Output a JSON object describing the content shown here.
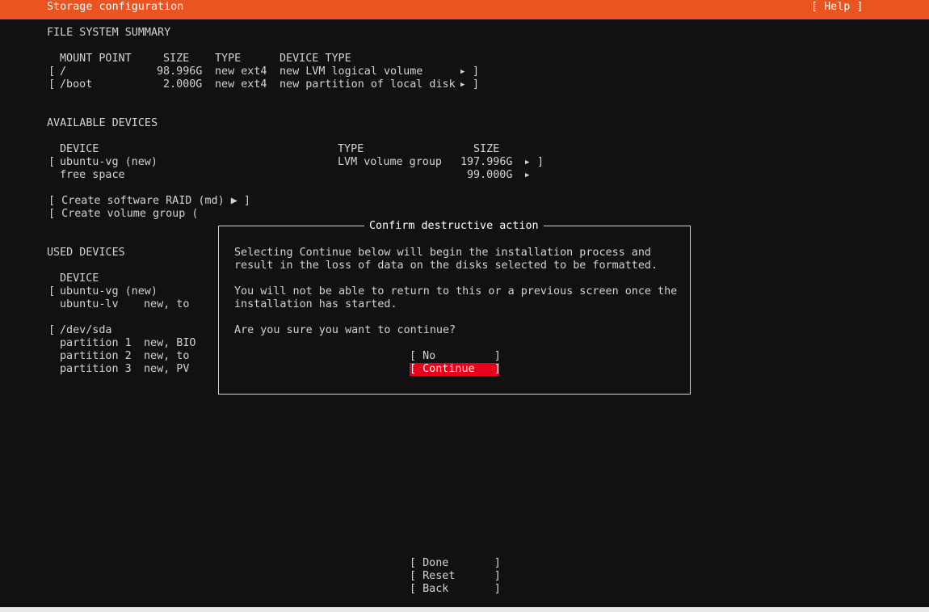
{
  "header": {
    "title": "Storage configuration",
    "help": "[ Help ]"
  },
  "fs_summary": {
    "heading": "FILE SYSTEM SUMMARY",
    "columns": {
      "mount": "MOUNT POINT",
      "size": "SIZE",
      "type": "TYPE",
      "device_type": "DEVICE TYPE"
    },
    "rows": [
      {
        "bracket_open": "[",
        "mount": "/",
        "size": "98.996G",
        "type": "new ext4",
        "device_type": "new LVM logical volume",
        "arrow": "▶",
        "bracket_close": "]"
      },
      {
        "bracket_open": "[",
        "mount": "/boot",
        "size": "2.000G",
        "type": "new ext4",
        "device_type": "new partition of local disk",
        "arrow": "▶",
        "bracket_close": "]"
      }
    ]
  },
  "available": {
    "heading": "AVAILABLE DEVICES",
    "columns": {
      "device": "DEVICE",
      "type": "TYPE",
      "size": "SIZE"
    },
    "rows": [
      {
        "bracket_open": "[",
        "device": "ubuntu-vg (new)",
        "type": "LVM volume group",
        "size": "197.996G",
        "arrow": "▶",
        "bracket_close": "]"
      },
      {
        "device": "free space",
        "size": "99.000G",
        "arrow": "▶"
      }
    ],
    "create_raid": "[ Create software RAID (md) ▶ ]",
    "create_vg": "[ Create volume group ("
  },
  "used": {
    "heading": "USED DEVICES",
    "column_device": "DEVICE",
    "rows": [
      {
        "bracket": "[",
        "device": "ubuntu-vg (new)",
        "info": ""
      },
      {
        "device": "ubuntu-lv",
        "info": "new, to"
      },
      {
        "bracket": "[",
        "device": "/dev/sda",
        "info": ""
      },
      {
        "device": "partition 1",
        "info": "new, BIO"
      },
      {
        "device": "partition 2",
        "info": "new, to"
      },
      {
        "device": "partition 3",
        "info": "new, PV"
      }
    ]
  },
  "dialog": {
    "title": "Confirm destructive action",
    "line1": "Selecting Continue below will begin the installation process and",
    "line2": "result in the loss of data on the disks selected to be formatted.",
    "line3": "You will not be able to return to this or a previous screen once the",
    "line4": "installation has started.",
    "question": "Are you sure you want to continue?",
    "no": "[ No         ]",
    "continue": "[ Continue   ]"
  },
  "footer": {
    "done": "[ Done       ]",
    "reset": "[ Reset      ]",
    "back": "[ Back       ]"
  },
  "colors": {
    "accent": "#e95420",
    "focus": "#e6001a",
    "background": "#111111",
    "text": "#d3d3d3"
  }
}
